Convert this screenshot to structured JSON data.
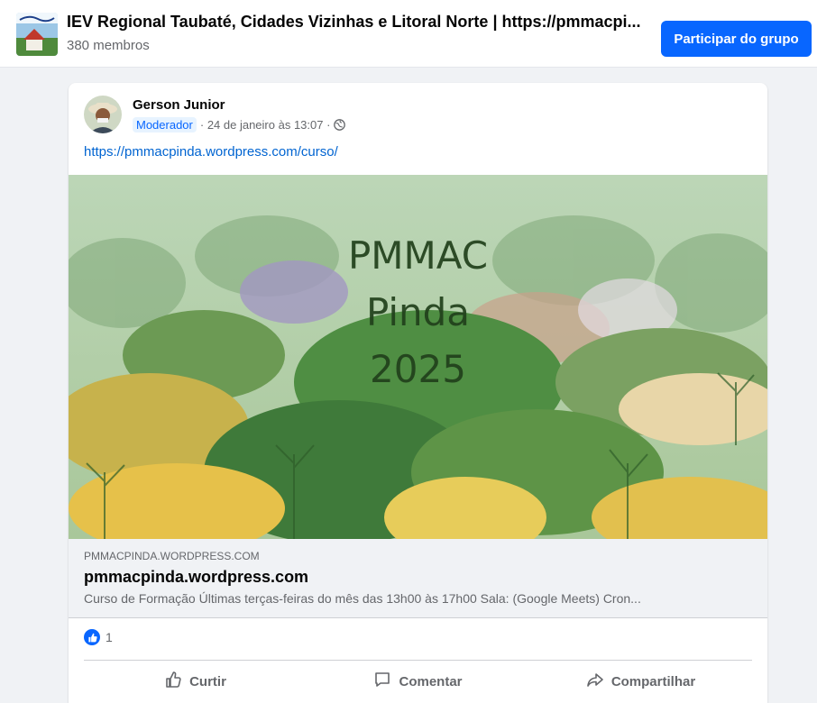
{
  "group": {
    "title": "IEV Regional Taubaté, Cidades Vizinhas e Litoral Norte | https://pmmacpi...",
    "members": "380 membros",
    "join_label": "Participar do grupo"
  },
  "post": {
    "author": "Gerson Junior",
    "badge": "Moderador",
    "timestamp": " · 24 de janeiro às 13:07 ·",
    "link": "https://pmmacpinda.wordpress.com/curso/",
    "image_text": [
      "PMMAC",
      "Pinda",
      "2025"
    ],
    "preview": {
      "domain": "PMMACPINDA.WORDPRESS.COM",
      "title": "pmmacpinda.wordpress.com",
      "description": "Curso de Formação Últimas terças-feiras do mês das 13h00 às 17h00 Sala: (Google Meets) Cron..."
    },
    "reactions": {
      "likes": "1"
    },
    "actions": {
      "like": "Curtir",
      "comment": "Comentar",
      "share": "Compartilhar"
    }
  },
  "colors": {
    "brand_blue": "#0866ff",
    "link_blue": "#0064d1",
    "muted": "#65676b"
  },
  "icons": [
    "group-thumbnail",
    "avatar",
    "globe-icon",
    "like-icon",
    "thumb-up-icon",
    "comment-icon",
    "share-icon"
  ]
}
